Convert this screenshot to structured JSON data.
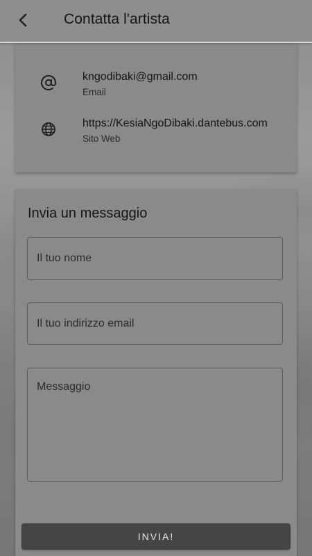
{
  "app_bar": {
    "title": "Contatta l'artista",
    "back_icon": "chevron-left-icon"
  },
  "contact": {
    "items": [
      {
        "icon": "at-sign-icon",
        "value": "kngodibaki@gmail.com",
        "label": "Email"
      },
      {
        "icon": "globe-icon",
        "value": "https://KesiaNgoDibaki.dantebus.com",
        "label": "Sito Web"
      }
    ]
  },
  "form": {
    "title": "Invia un messaggio",
    "name_placeholder": "Il tuo nome",
    "email_placeholder": "Il tuo indirizzo email",
    "message_placeholder": "Messaggio",
    "submit_label": "INVIA!"
  },
  "colors": {
    "appbar_bg": "#8e8e8e",
    "card_bg": "#8a8a8a",
    "button_bg": "#454545",
    "button_text": "#e6e6e6"
  }
}
